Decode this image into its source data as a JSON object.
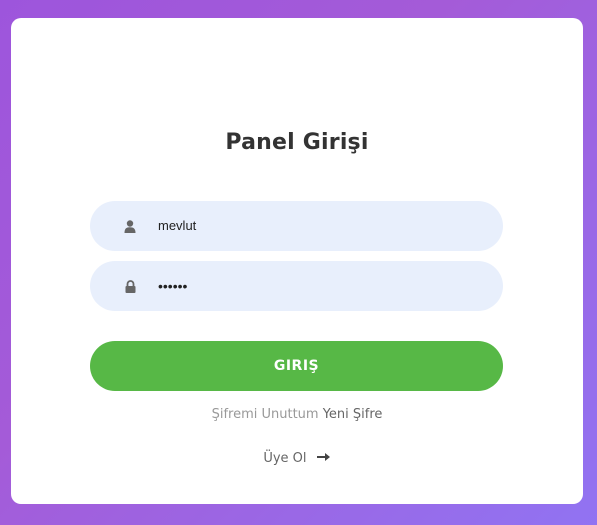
{
  "login": {
    "title": "Panel Girişi",
    "username_value": "mevlut",
    "password_value": "••••••",
    "submit_label": "GIRIŞ",
    "forgot_text": "Şifremi Unuttum",
    "forgot_link": "Yeni Şifre",
    "signup_label": "Üye Ol"
  },
  "icons": {
    "username": "user-icon",
    "password": "lock-icon",
    "signup": "arrow-right-icon"
  },
  "colors": {
    "submit_button": "#57b846",
    "input_background": "#e8effc",
    "background_gradient_start": "#9d55dc",
    "background_gradient_end": "#9173f2"
  }
}
